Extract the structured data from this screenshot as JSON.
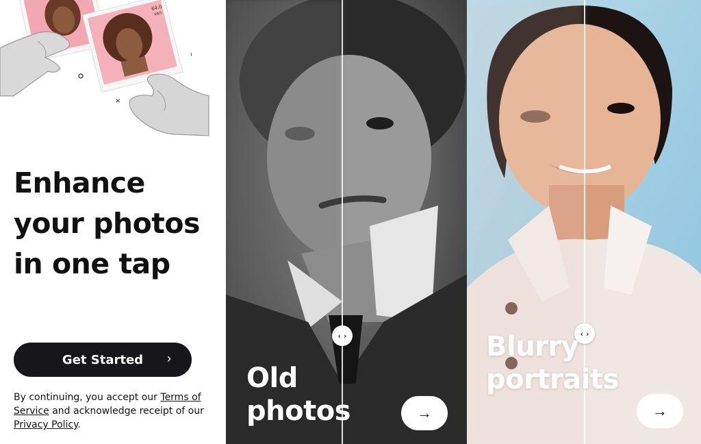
{
  "onboarding": {
    "headline": "Enhance your photos in one tap",
    "cta_label": "Get Started",
    "cta_chevron": "›",
    "legal": {
      "prefix": "By continuing, you accept our ",
      "terms_link": "Terms of Service",
      "middle": " and acknowledge receipt of our ",
      "privacy_link": "Privacy Policy",
      "suffix": "."
    },
    "illustration": {
      "icon": "photo-prints-in-hands-icon",
      "mini_status": "64.0",
      "mini_unit": "KB/S"
    }
  },
  "cards": [
    {
      "id": "old-photos",
      "title": "Old photos",
      "handle_glyph": "‹ ›",
      "arrow_glyph": "→"
    },
    {
      "id": "blurry-portraits",
      "title": "Blurry portraits",
      "handle_glyph": "‹ ›",
      "arrow_glyph": "→"
    }
  ],
  "colors": {
    "cta_bg": "#17171b",
    "text": "#111111",
    "blur_card_bg": "#a9d1e4",
    "old_card_bg": "#4a4a4a",
    "pink_photo_bg": "#f2a8b2"
  }
}
